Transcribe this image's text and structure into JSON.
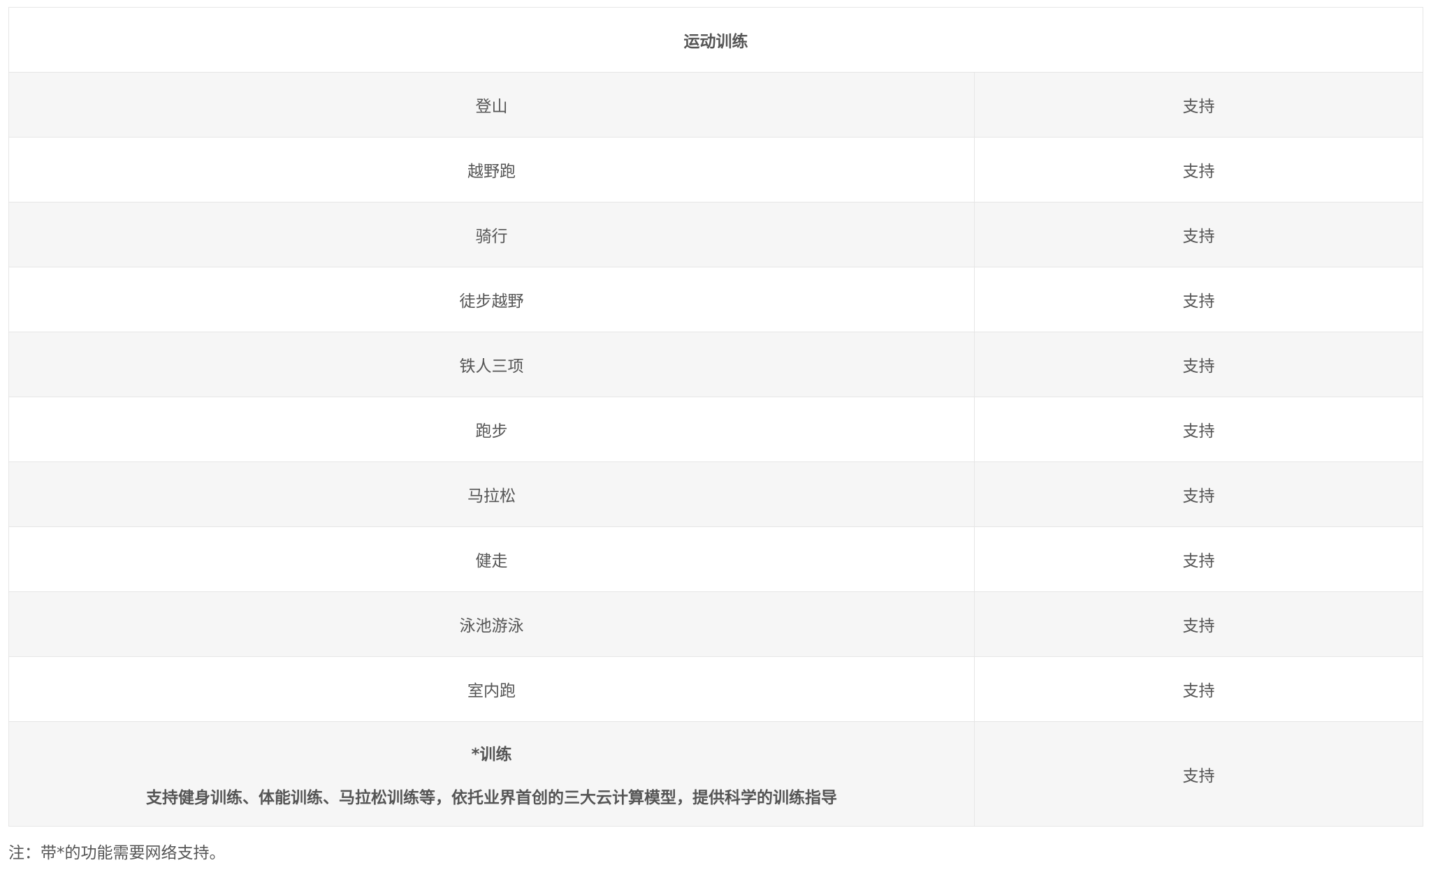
{
  "table": {
    "title": "运动训练",
    "rows": [
      {
        "name": "登山",
        "value": "支持"
      },
      {
        "name": "越野跑",
        "value": "支持"
      },
      {
        "name": "骑行",
        "value": "支持"
      },
      {
        "name": "徒步越野",
        "value": "支持"
      },
      {
        "name": "铁人三项",
        "value": "支持"
      },
      {
        "name": "跑步",
        "value": "支持"
      },
      {
        "name": "马拉松",
        "value": "支持"
      },
      {
        "name": "健走",
        "value": "支持"
      },
      {
        "name": "泳池游泳",
        "value": "支持"
      },
      {
        "name": "室内跑",
        "value": "支持"
      }
    ],
    "last": {
      "name": "*训练",
      "description": "支持健身训练、体能训练、马拉松训练等，依托业界首创的三大云计算模型，提供科学的训练指导",
      "value": "支持"
    }
  },
  "note": "注：带*的功能需要网络支持。"
}
